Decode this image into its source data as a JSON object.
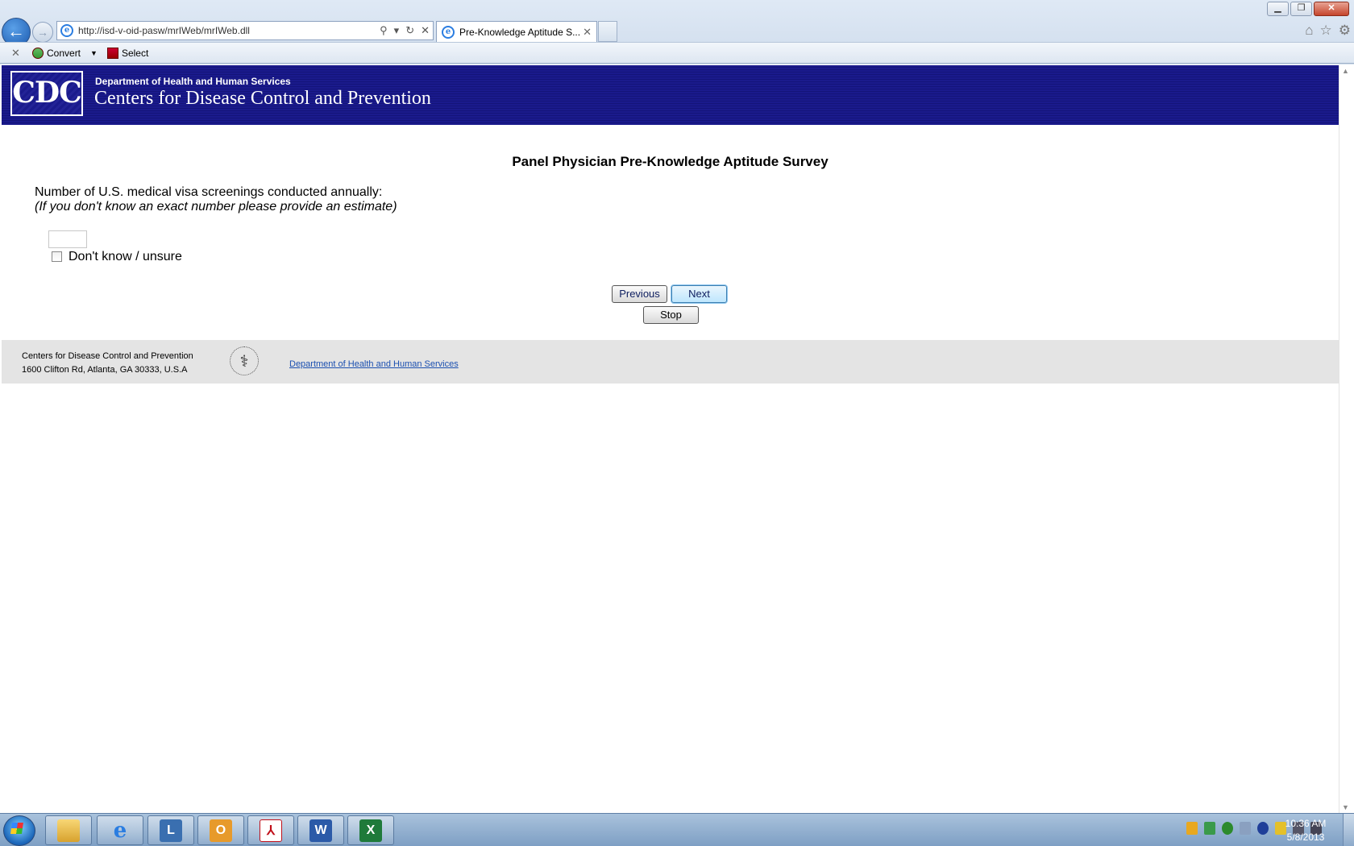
{
  "browser": {
    "url": "http://isd-v-oid-pasw/mrIWeb/mrIWeb.dll",
    "tab_title": "Pre-Knowledge Aptitude S...",
    "command_bar": {
      "convert_label": "Convert",
      "select_label": "Select"
    }
  },
  "header": {
    "logo_text": "CDC",
    "department": "Department of Health and Human Services",
    "organization": "Centers for Disease Control and Prevention"
  },
  "survey": {
    "title": "Panel Physician Pre-Knowledge Aptitude Survey",
    "question": "Number of U.S. medical visa screenings conducted annually:",
    "hint": "(If you don't know an exact number please provide an estimate)",
    "answer_value": "",
    "dont_know_label": "Don't know / unsure",
    "dont_know_checked": false,
    "previous_label": "Previous",
    "next_label": "Next",
    "stop_label": "Stop"
  },
  "footer": {
    "org": "Centers for Disease Control and Prevention",
    "address": "1600 Clifton Rd, Atlanta, GA 30333, U.S.A",
    "hhs_link": "Department of Health and Human Services"
  },
  "taskbar": {
    "apps": [
      "windows-explorer",
      "internet-explorer",
      "lync",
      "outlook",
      "adobe-reader",
      "word",
      "excel"
    ],
    "time": "10:36 AM",
    "date": "5/8/2013"
  },
  "colors": {
    "banner": "#1a1a8c",
    "footer_bg": "#e4e4e4",
    "link": "#1a4fb0"
  }
}
